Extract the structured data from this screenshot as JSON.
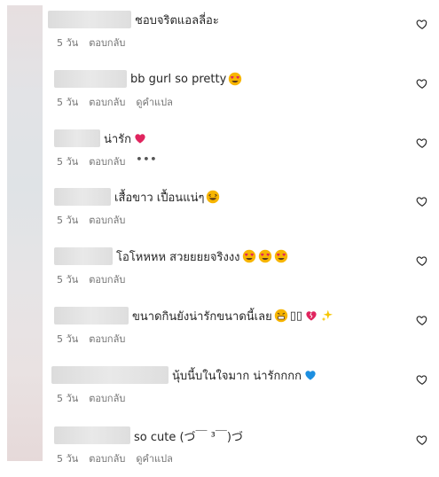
{
  "comments": [
    {
      "text": "ชอบจริตแอลลี่อะ",
      "time": "5 วัน",
      "reply": "ตอบกลับ",
      "translate": "",
      "more": "",
      "emoji": []
    },
    {
      "text": "bb gurl so pretty",
      "time": "5 วัน",
      "reply": "ตอบกลับ",
      "translate": "ดูคำแปล",
      "more": "",
      "emoji": [
        "heart-eyes"
      ]
    },
    {
      "text": "น่ารัก",
      "time": "5 วัน",
      "reply": "ตอบกลับ",
      "translate": "",
      "more": "•••",
      "emoji": [
        "heart"
      ]
    },
    {
      "text": "เสื้อขาว เปื้อนแน่ๆ",
      "time": "5 วัน",
      "reply": "ตอบกลับ",
      "translate": "",
      "more": "",
      "emoji": [
        "laugh"
      ]
    },
    {
      "text": "โอโหหหห สวยยยยจริงงง",
      "time": "5 วัน",
      "reply": "ตอบกลับ",
      "translate": "",
      "more": "",
      "emoji": [
        "heart-eyes",
        "heart-eyes",
        "heart-eyes"
      ]
    },
    {
      "text": "ขนาดกินยังน่ารักขนาดนี้เลย",
      "time": "5 วัน",
      "reply": "ตอบกลับ",
      "translate": "",
      "more": "",
      "emoji": [
        "grin",
        "box",
        "box",
        "heart",
        "sparkles"
      ]
    },
    {
      "text": "นุ้บนี้บในใจมาก น่ารักกกก",
      "time": "5 วัน",
      "reply": "ตอบกลับ",
      "translate": "",
      "more": "",
      "emoji": [
        "blue-heart"
      ]
    },
    {
      "text": "so cute (づ￣ ³￣)づ",
      "time": "5 วัน",
      "reply": "ตอบกลับ",
      "translate": "ดูคำแปล",
      "more": "",
      "emoji": []
    }
  ],
  "icons": {
    "like": "heart-outline-icon"
  },
  "colors": {
    "meta": "#737373",
    "text": "#262626",
    "heart": "#e0245e"
  }
}
